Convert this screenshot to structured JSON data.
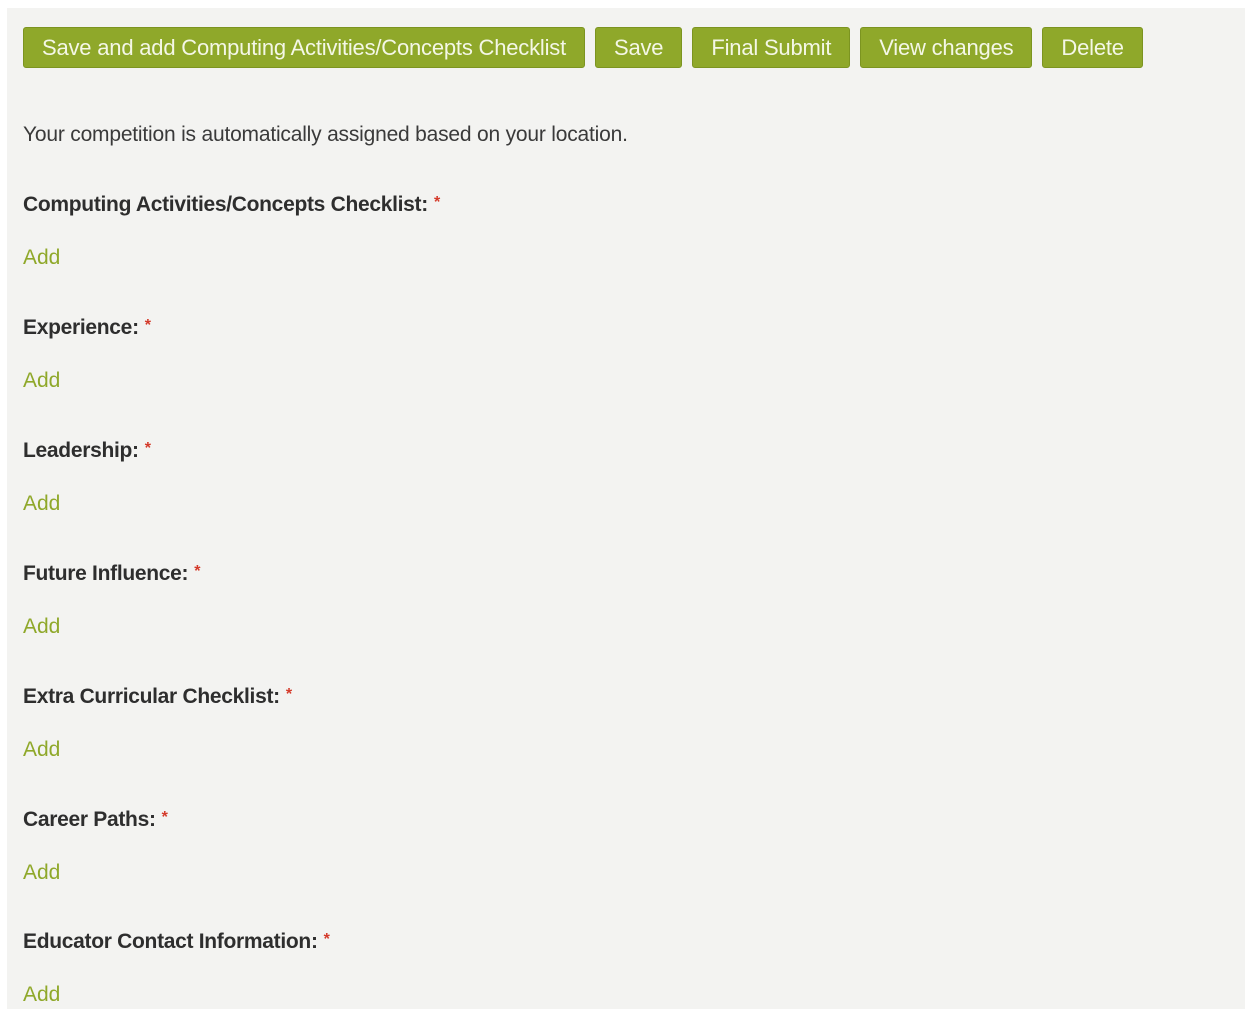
{
  "toolbar": {
    "buttons": [
      {
        "label": "Save and add Computing Activities/Concepts Checklist"
      },
      {
        "label": "Save"
      },
      {
        "label": "Final Submit"
      },
      {
        "label": "View changes"
      },
      {
        "label": "Delete"
      }
    ]
  },
  "intro_text": "Your competition is automatically assigned based on your location.",
  "required_marker": "*",
  "sections": [
    {
      "label": "Computing Activities/Concepts Checklist:",
      "add_label": "Add"
    },
    {
      "label": "Experience:",
      "add_label": "Add"
    },
    {
      "label": "Leadership:",
      "add_label": "Add"
    },
    {
      "label": "Future Influence:",
      "add_label": "Add"
    },
    {
      "label": "Extra Curricular Checklist:",
      "add_label": "Add"
    },
    {
      "label": "Career Paths:",
      "add_label": "Add"
    },
    {
      "label": "Educator Contact Information:",
      "add_label": "Add"
    }
  ],
  "colors": {
    "accent": "#8fa82a",
    "required": "#d43a2a",
    "background": "#f3f3f1"
  }
}
